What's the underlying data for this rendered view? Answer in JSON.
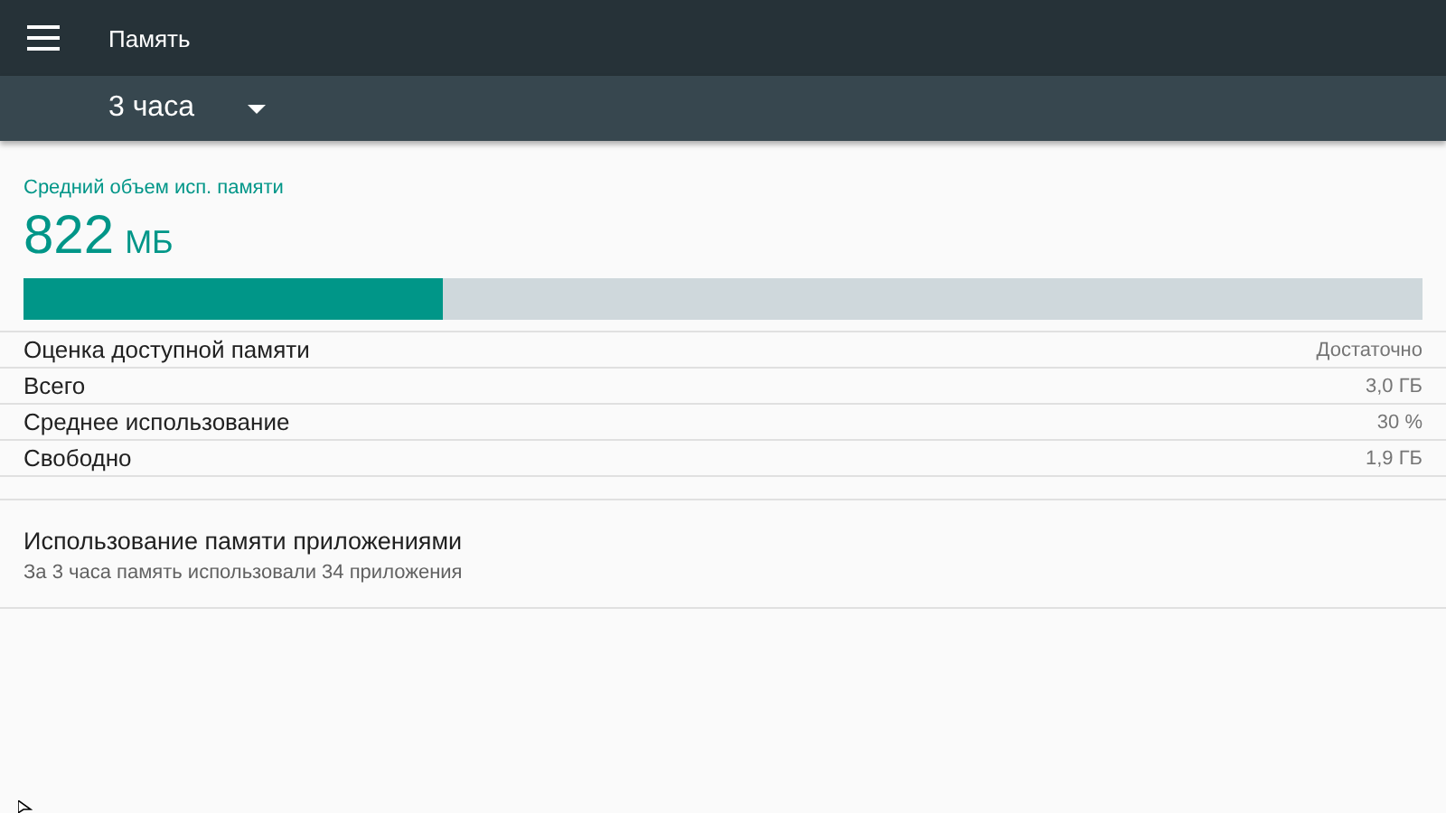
{
  "app_bar": {
    "title": "Память"
  },
  "period": {
    "value": "3 часа"
  },
  "summary": {
    "label": "Средний объем исп. памяти",
    "amount": "822",
    "unit": "МБ",
    "level": 0.3
  },
  "stats": [
    {
      "name": "Оценка доступной памяти",
      "value": "Достаточно"
    },
    {
      "name": "Всего",
      "value": "3,0 ГБ"
    },
    {
      "name": "Среднее использование",
      "value": "30 %"
    },
    {
      "name": "Свободно",
      "value": "1,9 ГБ"
    }
  ],
  "apps_item": {
    "title": "Использование памяти приложениями",
    "subtitle": "За 3 часа память использовали 34 приложения"
  }
}
